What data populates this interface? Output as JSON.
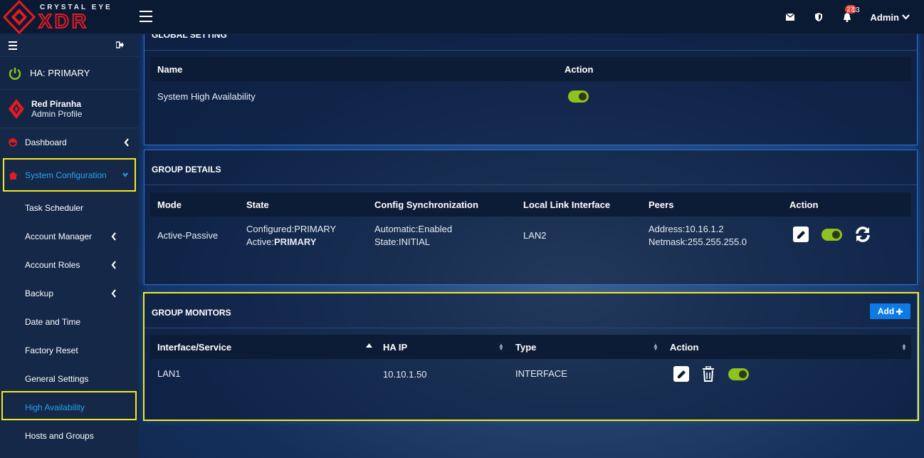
{
  "brand": {
    "sub": "CRYSTAL EYE",
    "main": "XDR"
  },
  "topbar": {
    "notif_badge": "27",
    "notif_count": "13",
    "user": "Admin"
  },
  "sidebar": {
    "ha_label": "HA: PRIMARY",
    "profile_name": "Red Piranha",
    "profile_role": "Admin Profile",
    "items": [
      {
        "label": "Dashboard"
      },
      {
        "label": "System Configuration"
      },
      {
        "label": "Task Scheduler"
      },
      {
        "label": "Account Manager"
      },
      {
        "label": "Account Roles"
      },
      {
        "label": "Backup"
      },
      {
        "label": "Date and Time"
      },
      {
        "label": "Factory Reset"
      },
      {
        "label": "General Settings"
      },
      {
        "label": "High Availability"
      },
      {
        "label": "Hosts and Groups"
      }
    ]
  },
  "global": {
    "title": "GLOBAL SETTING",
    "col_name": "Name",
    "col_action": "Action",
    "row_name": "System High Availability"
  },
  "group_details": {
    "title": "GROUP DETAILS",
    "headers": [
      "Mode",
      "State",
      "Config Synchronization",
      "Local Link Interface",
      "Peers",
      "Action"
    ],
    "row": {
      "mode": "Active-Passive",
      "state_configured": "Configured:PRIMARY",
      "state_active_label": "Active:",
      "state_active_value": "PRIMARY",
      "sync_line1": "Automatic:Enabled",
      "sync_line2": "State:INITIAL",
      "interface": "LAN2",
      "peer_address": "Address:10.16.1.2",
      "peer_netmask": "Netmask:255.255.255.0"
    }
  },
  "group_monitors": {
    "title": "GROUP MONITORS",
    "add_label": "Add",
    "headers": [
      "Interface/Service",
      "HA IP",
      "Type",
      "Action"
    ],
    "row": {
      "interface": "LAN1",
      "ha_ip": "10.10.1.50",
      "type": "INTERFACE"
    }
  },
  "colors": {
    "accent": "#22a7f0",
    "highlight": "#f4e91e",
    "toggle_on": "#8dc21f",
    "brand_red": "#e31b23",
    "add_button": "#0d7ae5"
  }
}
